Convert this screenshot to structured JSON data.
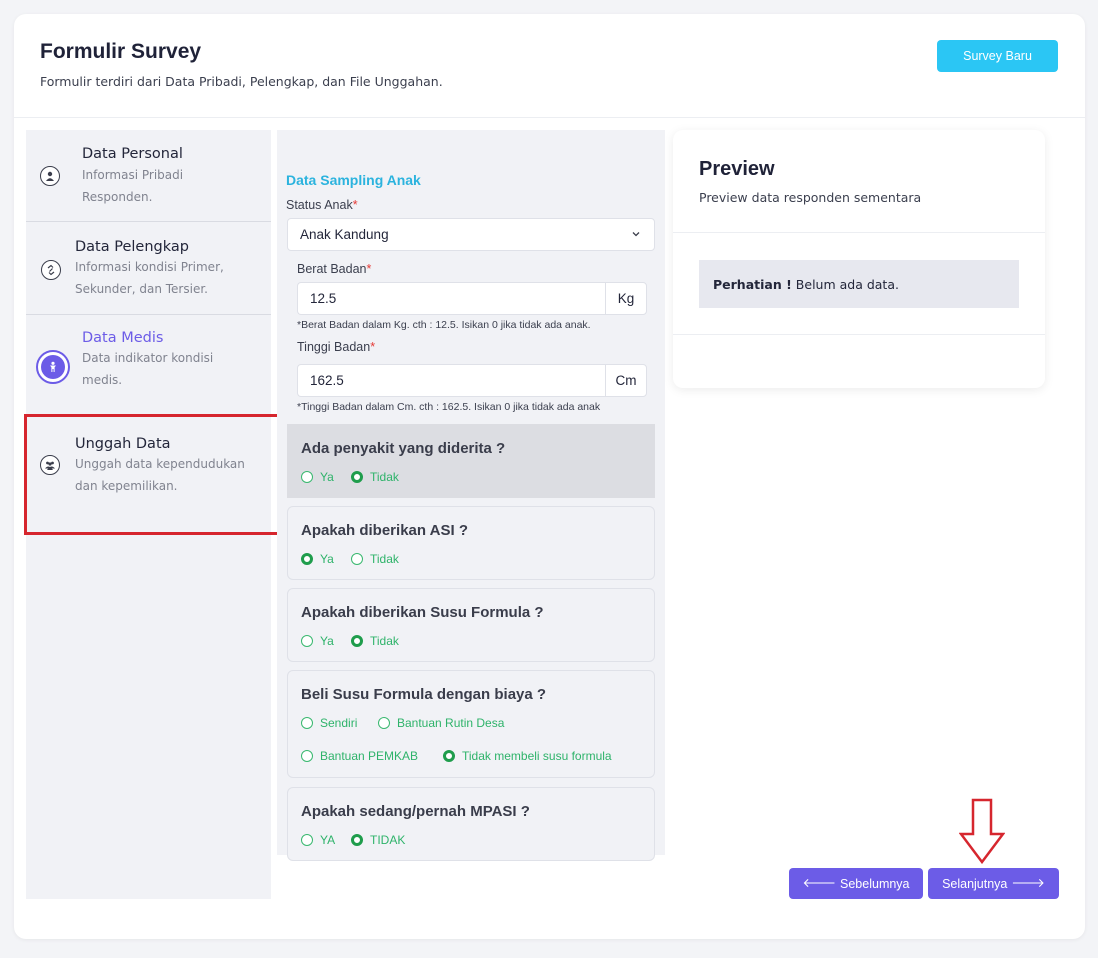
{
  "header": {
    "title": "Formulir Survey",
    "subtitle": "Formulir terdiri dari Data Pribadi, Pelengkap, dan File Unggahan.",
    "new_button": "Survey Baru"
  },
  "steps": [
    {
      "title": "Data Personal",
      "desc_line1": "Informasi Pribadi",
      "desc_line2": "Responden.",
      "icon": "user-icon"
    },
    {
      "title": "Data Pelengkap",
      "desc_line1": "Informasi kondisi Primer,",
      "desc_line2": "Sekunder, dan Tersier.",
      "icon": "link-icon"
    },
    {
      "title": "Data Medis",
      "desc_line1": "Data indikator kondisi",
      "desc_line2": "medis.",
      "icon": "child-icon",
      "active": true
    },
    {
      "title": "Unggah Data",
      "desc_line1": "Unggah data kependudukan",
      "desc_line2": "dan kepemilikan.",
      "icon": "users-icon"
    }
  ],
  "form": {
    "section_title": "Data Sampling Anak",
    "status_anak": {
      "label": "Status Anak",
      "value": "Anak Kandung"
    },
    "berat_badan": {
      "label": "Berat Badan",
      "value": "12.5",
      "unit": "Kg",
      "hint": "*Berat Badan dalam Kg. cth : 12.5. Isikan 0 jika tidak ada anak."
    },
    "tinggi_badan": {
      "label": "Tinggi Badan",
      "value": "162.5",
      "unit": "Cm",
      "hint": "*Tinggi Badan dalam Cm. cth : 162.5. Isikan 0 jika tidak ada anak"
    },
    "questions": [
      {
        "title": "Ada penyakit yang diderita ?",
        "options": [
          "Ya",
          "Tidak"
        ],
        "selected": "Tidak"
      },
      {
        "title": "Apakah diberikan ASI ?",
        "options": [
          "Ya",
          "Tidak"
        ],
        "selected": "Ya"
      },
      {
        "title": "Apakah diberikan Susu Formula ?",
        "options": [
          "Ya",
          "Tidak"
        ],
        "selected": "Tidak"
      },
      {
        "title": "Beli Susu Formula dengan biaya ?",
        "options": [
          "Sendiri",
          "Bantuan Rutin Desa",
          "Bantuan PEMKAB",
          "Tidak membeli susu formula"
        ],
        "selected": "Tidak membeli susu formula"
      },
      {
        "title": "Apakah sedang/pernah MPASI ?",
        "options": [
          "YA",
          "TIDAK"
        ],
        "selected": "TIDAK"
      }
    ]
  },
  "preview": {
    "title": "Preview",
    "subtitle": "Preview data responden sementara",
    "alert_strong": "Perhatian !",
    "alert_text": "Belum ada data."
  },
  "nav": {
    "prev": "Sebelumnya",
    "next": "Selanjutnya"
  },
  "colors": {
    "accent": "#6c5ce7",
    "cyan": "#2bc6f4",
    "green": "#2eb36a",
    "highlight": "#d6262e"
  }
}
